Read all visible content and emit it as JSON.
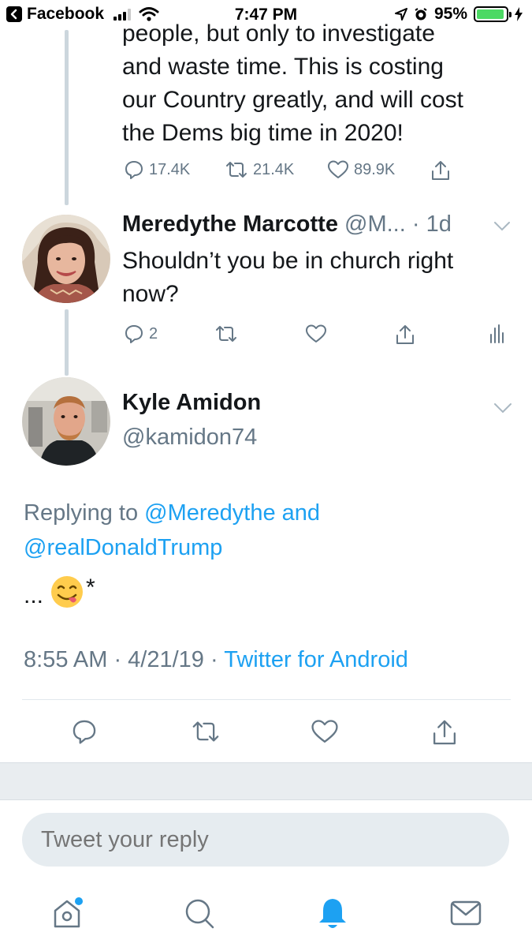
{
  "status_bar": {
    "back_app": "Facebook",
    "time": "7:47 PM",
    "battery": "95%",
    "battery_level": 0.95
  },
  "parent_tweet": {
    "text_lines": [
      "people, but only to investigate",
      "and waste time. This is costing",
      "our Country greatly, and will cost",
      "the Dems big time in 2020!"
    ],
    "replies": "17.4K",
    "retweets": "21.4K",
    "likes": "89.9K"
  },
  "reply_tweet": {
    "name": "Meredythe Marcotte",
    "handle_truncated": "@M...",
    "age": "· 1d",
    "text_lines": [
      "Shouldn’t you be in church right",
      "now?"
    ],
    "replies": "2"
  },
  "main_tweet": {
    "name": "Kyle Amidon",
    "handle": "@kamidon74",
    "replying_prefix": "Replying to",
    "replying_user1": "@Meredythe",
    "replying_and": "and",
    "replying_user2": "@realDonaldTrump",
    "text_dots": "...",
    "text_star": "*",
    "timestamp": "8:55 AM · 4/21/19 ·",
    "source": "Twitter for Android"
  },
  "reply_box": {
    "placeholder": "Tweet your reply"
  },
  "tabs": [
    "home-icon",
    "search-icon",
    "notifications-icon",
    "messages-icon"
  ],
  "colors": {
    "link": "#1da1f2",
    "secondary_text": "#657786",
    "active_tab": "#1da1f2"
  }
}
